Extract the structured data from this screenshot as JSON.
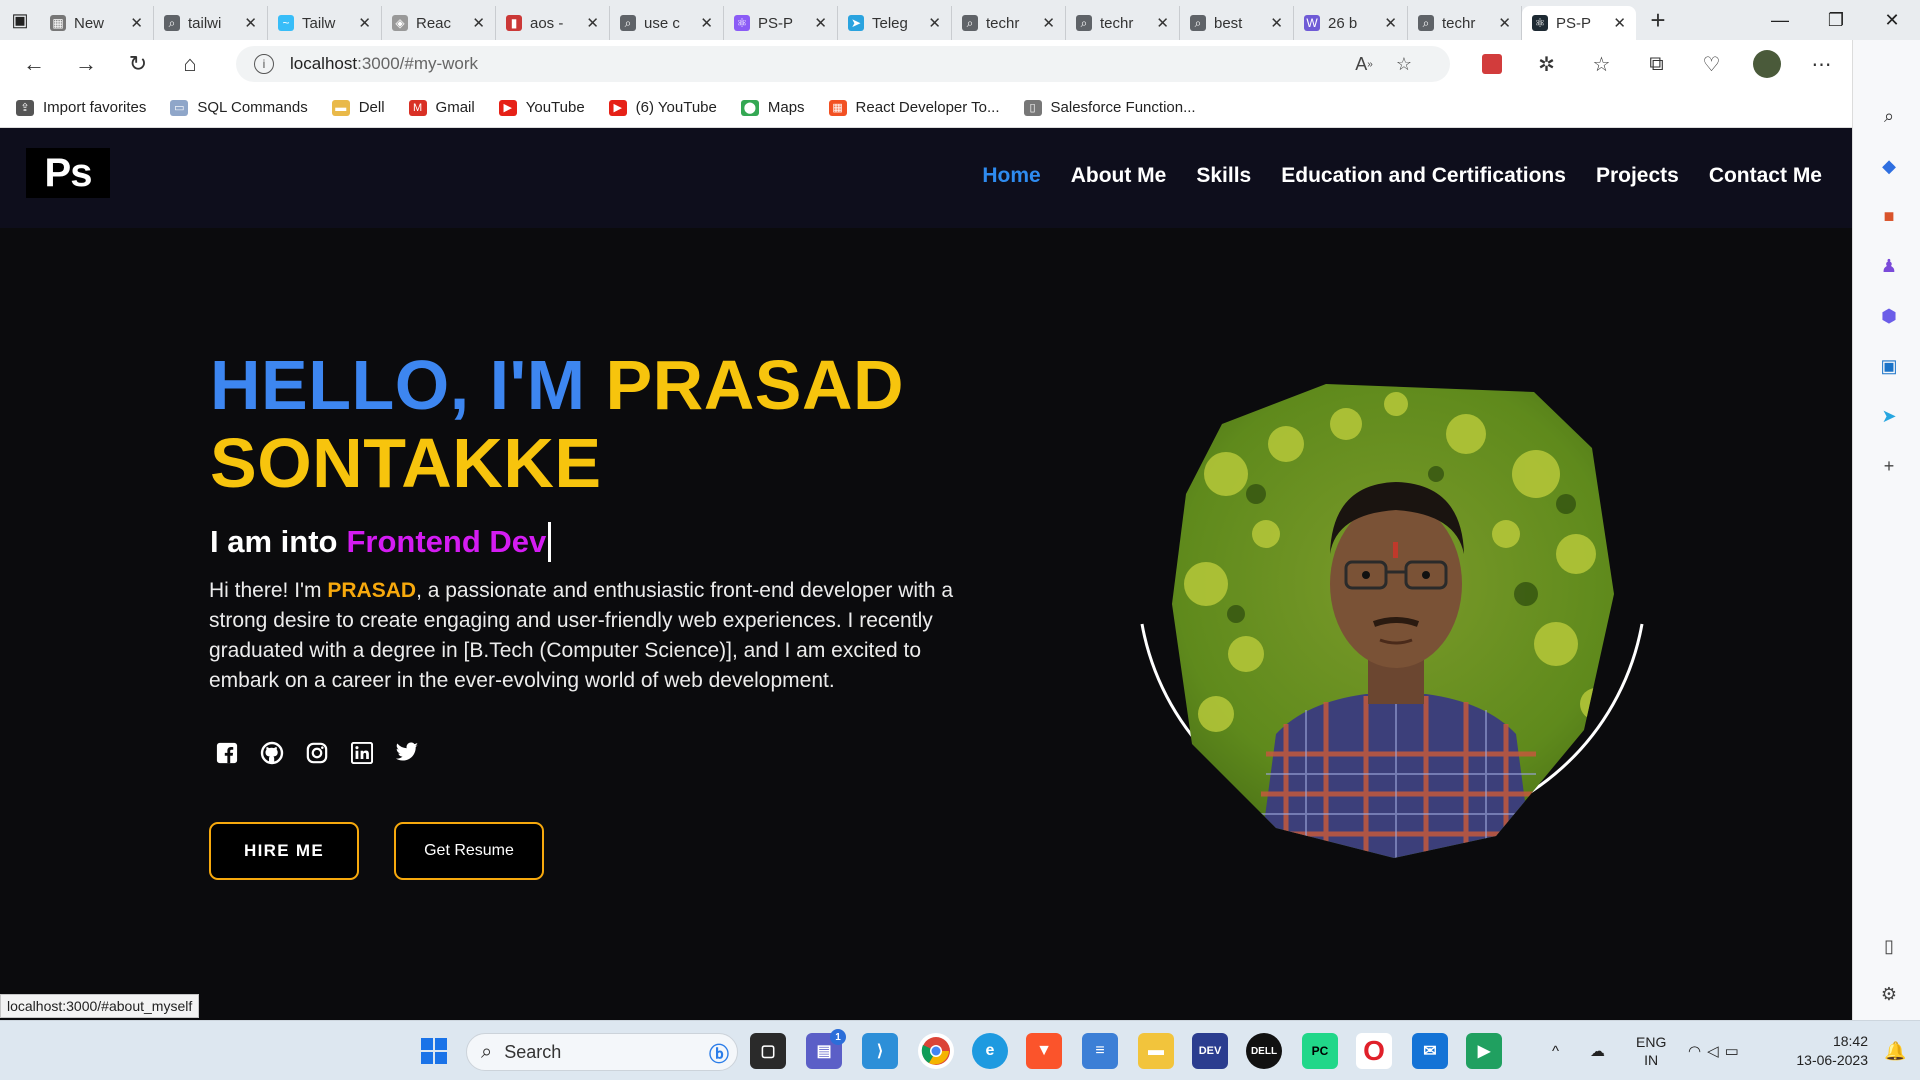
{
  "browser": {
    "tabs": [
      {
        "label": "New",
        "color": "#777777",
        "glyph": "▦"
      },
      {
        "label": "tailwi",
        "color": "#5f6368",
        "glyph": "⌕"
      },
      {
        "label": "Tailw",
        "color": "#38bdf8",
        "glyph": "~"
      },
      {
        "label": "Reac",
        "color": "#999999",
        "glyph": "◈"
      },
      {
        "label": "aos -",
        "color": "#cb3837",
        "glyph": "▮"
      },
      {
        "label": "use c",
        "color": "#5f6368",
        "glyph": "⌕"
      },
      {
        "label": "PS-P",
        "color": "#8b5cf6",
        "glyph": "⚛"
      },
      {
        "label": "Teleg",
        "color": "#2aa3df",
        "glyph": "➤"
      },
      {
        "label": "techr",
        "color": "#5f6368",
        "glyph": "⌕"
      },
      {
        "label": "techr",
        "color": "#5f6368",
        "glyph": "⌕"
      },
      {
        "label": "best",
        "color": "#5f6368",
        "glyph": "⌕"
      },
      {
        "label": "26 b",
        "color": "#6f5bd6",
        "glyph": "W"
      },
      {
        "label": "techr",
        "color": "#5f6368",
        "glyph": "⌕"
      },
      {
        "label": "PS-P",
        "color": "#1e2a33",
        "glyph": "⚛",
        "active": true
      }
    ],
    "url_host": "localhost",
    "url_path": ":3000/#my-work",
    "favorites": [
      {
        "label": "Import favorites",
        "color": "#555555",
        "glyph": "⇪"
      },
      {
        "label": "SQL Commands",
        "color": "#8fa6c9",
        "glyph": "▭"
      },
      {
        "label": "Dell",
        "color": "#e9b949",
        "glyph": "▬"
      },
      {
        "label": "Gmail",
        "color": "#d93025",
        "glyph": "M"
      },
      {
        "label": "YouTube",
        "color": "#e62117",
        "glyph": "▶"
      },
      {
        "label": "(6) YouTube",
        "color": "#e62117",
        "glyph": "▶"
      },
      {
        "label": "Maps",
        "color": "#34a853",
        "glyph": "⬤"
      },
      {
        "label": "React Developer To...",
        "color": "#f25022",
        "glyph": "▦"
      },
      {
        "label": "Salesforce Function...",
        "color": "#777777",
        "glyph": "▯"
      }
    ],
    "status_url": "localhost:3000/#about_myself"
  },
  "site": {
    "logo": "Ps",
    "nav": [
      "Home",
      "About Me",
      "Skills",
      "Education and Certifications",
      "Projects",
      "Contact Me"
    ],
    "hero": {
      "greeting": "HELLO, I'M",
      "first_name": "PRASAD",
      "last_name": "SONTAKKE",
      "tagline_prefix": "I am into",
      "tagline_role": "Frontend Dev",
      "bio_before": "Hi there! I'm ",
      "bio_name": "PRASAD",
      "bio_after": ", a passionate and enthusiastic front-end developer with a strong desire to create engaging and user-friendly web experiences. I recently graduated with a degree in [B.Tech (Computer Science)], and I am excited to embark on a career in the ever-evolving world of web development.",
      "socials": [
        "facebook-icon",
        "github-icon",
        "instagram-icon",
        "linkedin-icon",
        "twitter-icon"
      ],
      "hire_button": "HIRE ME",
      "resume_button": "Get Resume"
    }
  },
  "taskbar": {
    "search_placeholder": "Search",
    "language_line1": "ENG",
    "language_line2": "IN",
    "time": "18:42",
    "date": "13-06-2023",
    "teams_badge": "1"
  },
  "colors": {
    "accent_blue": "#3d86f0",
    "accent_yellow": "#f7c40d",
    "accent_pink": "#d41cf2",
    "accent_orange": "#f7a90d",
    "nav_active": "#2e8bef"
  }
}
